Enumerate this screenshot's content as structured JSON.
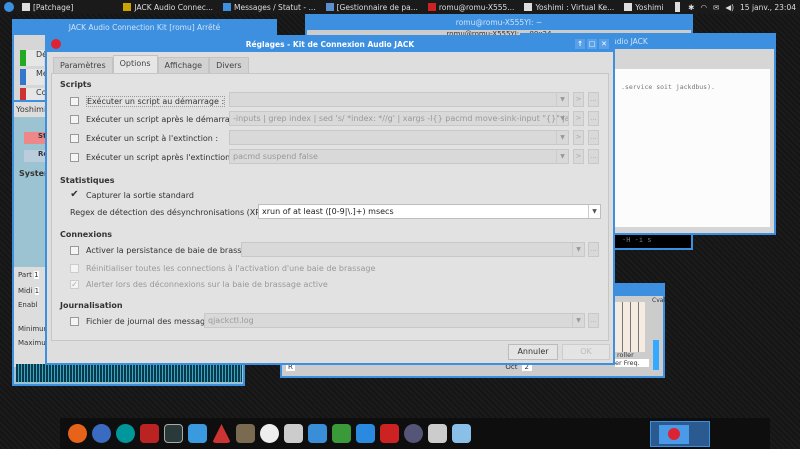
{
  "top_panel": {
    "tasks": [
      "[Patchage]",
      "JACK Audio Connec...",
      "Messages / Statut - ...",
      "[Gestionnaire de pa...",
      "romu@romu-X555...",
      "Yoshimi : Virtual Ke...",
      "Yoshimi"
    ],
    "clock": "15 janv., 23:04"
  },
  "background": {
    "jack_main_title": "JACK Audio Connection Kit [romu] Arrêté",
    "jack_buttons": [
      "Dé",
      "Me",
      "Co"
    ],
    "yoshimi": {
      "menu": "Yoshimi",
      "buttons": [
        "St",
        "Re"
      ],
      "tab": "Syster",
      "part_label": "Part",
      "part_value": "1",
      "midi_label": "Midi",
      "midi_value": "1",
      "enable_label": "Enabl",
      "minimum_label": "Minimur",
      "maximum_label": "Maximur"
    },
    "terminal_title": "romu@romu-X555YI: ~",
    "terminal_subtitle": "romu@romu-X555YI: ~ 80x24",
    "terminal_text": "-H -i s",
    "messages_title": "udio JACK",
    "messages_text": ".service soit jackdbus).",
    "keyboard": {
      "controller_label": "roller",
      "controller_value": "er Freq.",
      "octave_label": "Oct",
      "octave_value": "2",
      "cval": "Cval"
    }
  },
  "dialog": {
    "title": "Réglages - Kit de Connexion Audio JACK",
    "tabs": [
      "Paramètres",
      "Options",
      "Affichage",
      "Divers"
    ],
    "active_tab": "Options",
    "scripts": {
      "heading": "Scripts",
      "rows": [
        {
          "label": "Exécuter un script au démarrage :",
          "checked": false,
          "value": ""
        },
        {
          "label": "Exécuter un script après le démarrage :",
          "checked": false,
          "value": "-inputs | grep index | sed 's/ *index: *//g' | xargs -I{} pacmd move-sink-input \"{}\" jack_out"
        },
        {
          "label": "Exécuter un script à l'extinction :",
          "checked": false,
          "value": ""
        },
        {
          "label": "Exécuter un script après l'extinction :",
          "checked": false,
          "value": "pacmd suspend false"
        }
      ],
      "run_button": ">",
      "browse_button": "..."
    },
    "stats": {
      "heading": "Statistiques",
      "capture_label": "Capturer la sortie standard",
      "capture_checked": true,
      "xrun_label": "Regex de détection des désynchronisations (XRUN) :",
      "xrun_value": "xrun of at least ([0-9|\\.]+) msecs"
    },
    "connections": {
      "heading": "Connexions",
      "persist_label": "Activer la persistance de baie de brassage :",
      "persist_checked": false,
      "persist_value": "",
      "reset_label": "Réinitialiser toutes les connections à l'activation d'une baie de brassage",
      "reset_checked": false,
      "alert_label": "Alerter lors des déconnexions sur la baie de brassage active",
      "alert_checked": true
    },
    "logging": {
      "heading": "Journalisation",
      "log_label": "Fichier de journal des messages :",
      "log_checked": false,
      "log_value": "qjackctl.log"
    },
    "cancel": "Annuler",
    "ok": "OK"
  },
  "colors": {
    "accent": "#3d8fe0"
  }
}
